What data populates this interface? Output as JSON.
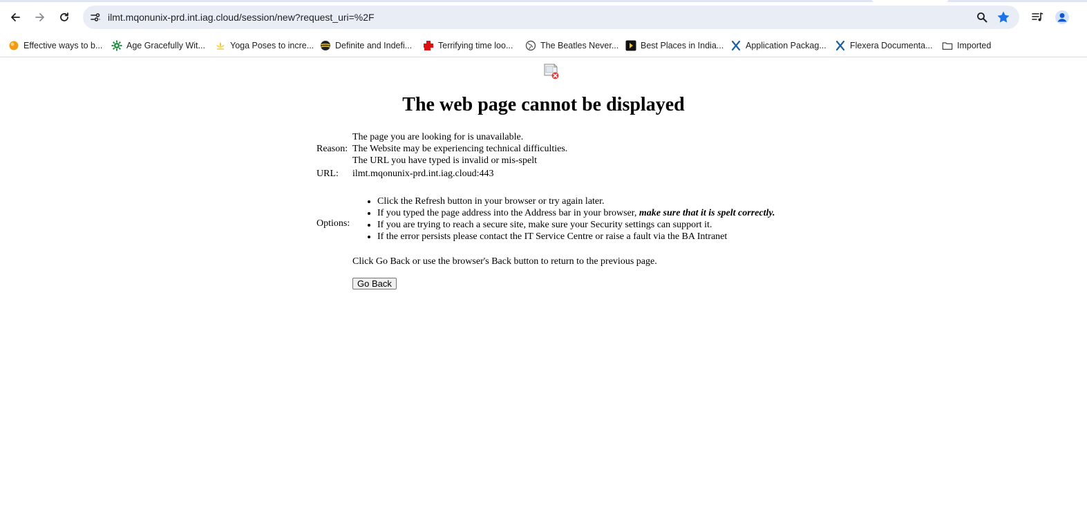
{
  "browser": {
    "url": "ilmt.mqonunix-prd.int.iag.cloud/session/new?request_uri=%2F",
    "back_icon": "arrow-left-icon",
    "forward_icon": "arrow-right-icon",
    "reload_icon": "reload-icon",
    "accent": "#1a73e8"
  },
  "bookmarks": [
    {
      "label": "Effective ways to b...",
      "icon": "orange-circle-icon"
    },
    {
      "label": "Age Gracefully Wit...",
      "icon": "green-gear-icon"
    },
    {
      "label": "Yoga Poses to incre...",
      "icon": "yellow-lotus-icon"
    },
    {
      "label": "Definite and Indefi...",
      "icon": "globe-dark-icon"
    },
    {
      "label": "Terrifying time loo...",
      "icon": "red-cross-icon"
    },
    {
      "label": "The Beatles Never...",
      "icon": "globe-icon"
    },
    {
      "label": "Best Places in India...",
      "icon": "play-icon"
    },
    {
      "label": "Application Packag...",
      "icon": "flexera-icon"
    },
    {
      "label": "Flexera Documenta...",
      "icon": "flexera-icon"
    },
    {
      "label": "Imported",
      "icon": "folder-icon"
    }
  ],
  "page": {
    "title": "The web page cannot be displayed",
    "reason_label": "Reason:",
    "reason_lines": [
      "The page you are looking for is unavailable.",
      "The Website may be experiencing technical difficulties.",
      "The URL you have typed is invalid or mis-spelt"
    ],
    "url_label": "URL:",
    "url_value": "ilmt.mqonunix-prd.int.iag.cloud:443",
    "options_label": "Options:",
    "options": [
      "Click the Refresh button in your browser or try again later.",
      "If you typed the page address into the Address bar in your browser, ",
      "If you are trying to reach a secure site, make sure your Security settings can support it.",
      "If the error persists please contact the IT Service Centre or raise a fault via the BA Intranet"
    ],
    "option2_emphasis": "make sure that it is spelt correctly.",
    "go_back_text": "Click Go Back or use the browser's Back button to return to the previous page.",
    "go_back_button": "Go Back"
  }
}
